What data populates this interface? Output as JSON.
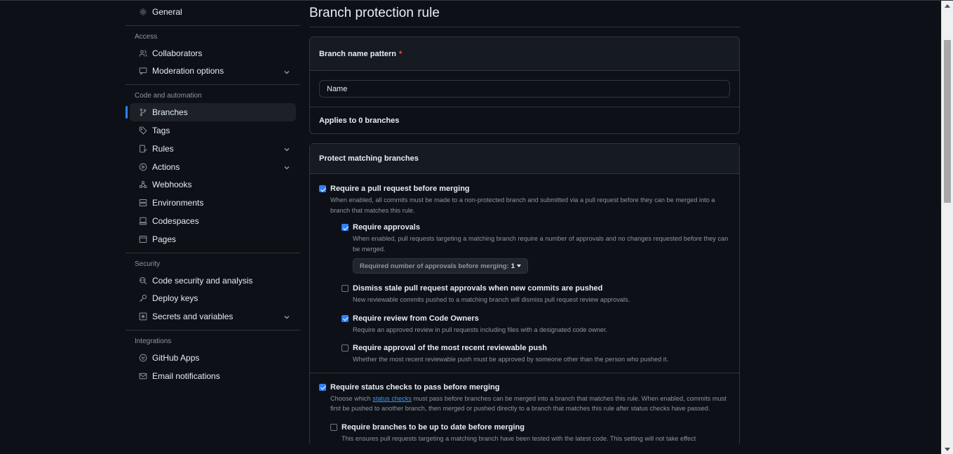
{
  "sidebar": {
    "top": {
      "label": "General",
      "icon": "gear-icon"
    },
    "sections": [
      {
        "title": "Access",
        "items": [
          {
            "label": "Collaborators",
            "icon": "people-icon",
            "chevron": false
          },
          {
            "label": "Moderation options",
            "icon": "comment-icon",
            "chevron": true
          }
        ]
      },
      {
        "title": "Code and automation",
        "items": [
          {
            "label": "Branches",
            "icon": "branch-icon",
            "chevron": false,
            "active": true
          },
          {
            "label": "Tags",
            "icon": "tag-icon",
            "chevron": false
          },
          {
            "label": "Rules",
            "icon": "rules-icon",
            "chevron": true
          },
          {
            "label": "Actions",
            "icon": "play-icon",
            "chevron": true
          },
          {
            "label": "Webhooks",
            "icon": "webhook-icon",
            "chevron": false
          },
          {
            "label": "Environments",
            "icon": "server-icon",
            "chevron": false
          },
          {
            "label": "Codespaces",
            "icon": "codespaces-icon",
            "chevron": false
          },
          {
            "label": "Pages",
            "icon": "browser-icon",
            "chevron": false
          }
        ]
      },
      {
        "title": "Security",
        "items": [
          {
            "label": "Code security and analysis",
            "icon": "codescan-icon",
            "chevron": false
          },
          {
            "label": "Deploy keys",
            "icon": "key-icon",
            "chevron": false
          },
          {
            "label": "Secrets and variables",
            "icon": "asterisk-icon",
            "chevron": true
          }
        ]
      },
      {
        "title": "Integrations",
        "items": [
          {
            "label": "GitHub Apps",
            "icon": "apps-icon",
            "chevron": false
          },
          {
            "label": "Email notifications",
            "icon": "mail-icon",
            "chevron": false
          }
        ]
      }
    ]
  },
  "main": {
    "title": "Branch protection rule",
    "pattern_header": "Branch name pattern",
    "required_mark": "*",
    "pattern_placeholder": "Name",
    "applies": "Applies to 0 branches",
    "protect_header": "Protect matching branches",
    "options": {
      "pr": {
        "title": "Require a pull request before merging",
        "desc": "When enabled, all commits must be made to a non-protected branch and submitted via a pull request before they can be merged into a branch that matches this rule.",
        "checked": true
      },
      "approvals": {
        "title": "Require approvals",
        "desc": "When enabled, pull requests targeting a matching branch require a number of approvals and no changes requested before they can be merged.",
        "checked": true,
        "dropdown_label": "Required number of approvals before merging:",
        "dropdown_value": "1"
      },
      "dismiss": {
        "title": "Dismiss stale pull request approvals when new commits are pushed",
        "desc": "New reviewable commits pushed to a matching branch will dismiss pull request review approvals.",
        "checked": false
      },
      "owners": {
        "title": "Require review from Code Owners",
        "desc": "Require an approved review in pull requests including files with a designated code owner.",
        "checked": true
      },
      "recent": {
        "title": "Require approval of the most recent reviewable push",
        "desc": "Whether the most recent reviewable push must be approved by someone other than the person who pushed it.",
        "checked": false
      },
      "status": {
        "title": "Require status checks to pass before merging",
        "desc_pre": "Choose which ",
        "desc_link": "status checks",
        "desc_post": " must pass before branches can be merged into a branch that matches this rule. When enabled, commits must first be pushed to another branch, then merged or pushed directly to a branch that matches this rule after status checks have passed.",
        "checked": true
      },
      "uptodate": {
        "title": "Require branches to be up to date before merging",
        "desc": "This ensures pull requests targeting a matching branch have been tested with the latest code. This setting will not take effect",
        "checked": false
      }
    }
  }
}
